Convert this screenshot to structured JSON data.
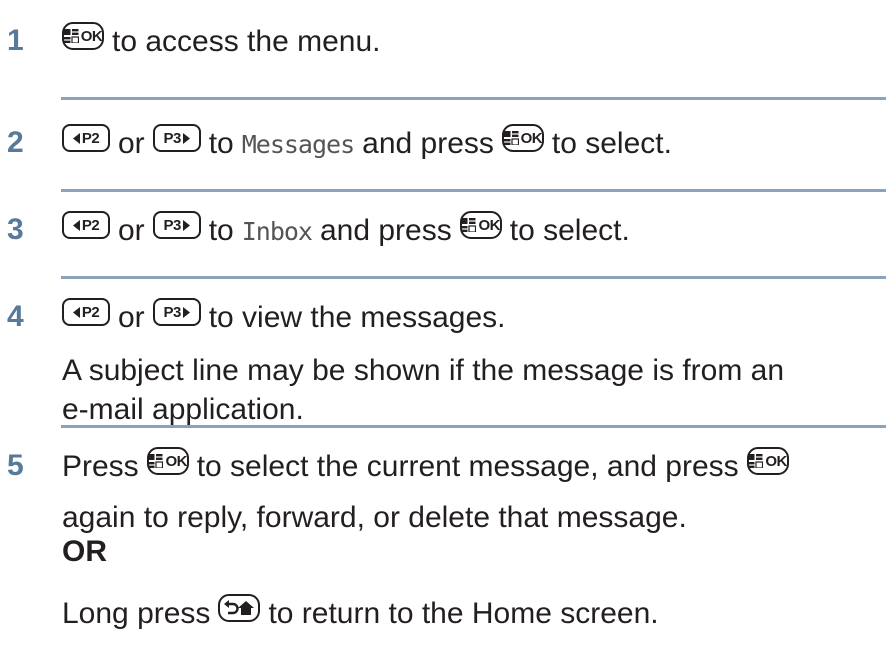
{
  "steps": [
    {
      "number": "1",
      "segments": [
        {
          "key": "ok"
        },
        {
          "text": "to access the menu."
        }
      ]
    },
    {
      "number": "2",
      "segments": [
        {
          "key": "p2"
        },
        {
          "text": "or"
        },
        {
          "key": "p3"
        },
        {
          "text": "to"
        },
        {
          "mono": "Messages"
        },
        {
          "text": "and press"
        },
        {
          "key": "ok"
        },
        {
          "text": "to select."
        }
      ]
    },
    {
      "number": "3",
      "segments": [
        {
          "key": "p2"
        },
        {
          "text": "or"
        },
        {
          "key": "p3"
        },
        {
          "text": "to"
        },
        {
          "mono": "Inbox"
        },
        {
          "text": "and press"
        },
        {
          "key": "ok"
        },
        {
          "text": "to select."
        }
      ]
    },
    {
      "number": "4",
      "segments": [
        {
          "key": "p2"
        },
        {
          "text": "or"
        },
        {
          "key": "p3"
        },
        {
          "text": "to view the messages."
        }
      ],
      "note_line1": "A subject line may be shown if the message is from an",
      "note_line2": "e-mail application."
    },
    {
      "number": "5",
      "line1_a": "Press",
      "line1_b": "to select the current message, and press",
      "line2": "again to reply, forward, or delete that message.",
      "or_label": "OR",
      "line3_a": "Long press",
      "line3_b": "to return to the Home screen."
    }
  ],
  "keys": {
    "ok": {
      "label": "OK",
      "icon": "menu-grid-icon"
    },
    "p2": {
      "label": "P2",
      "icon": "left-triangle-icon"
    },
    "p3": {
      "label": "P3",
      "icon": "right-triangle-icon"
    },
    "home": {
      "icon": "back-home-icon"
    }
  },
  "colors": {
    "step_number": "#58799a",
    "rule": "#8aa2bb",
    "text": "#231f20",
    "mono": "#555555"
  }
}
